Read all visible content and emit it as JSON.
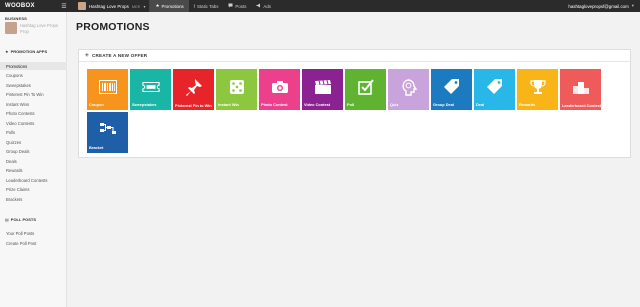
{
  "topbar": {
    "logo": "WOOBOX",
    "page_name": "Hashtag Love Props",
    "page_tag": "MEE",
    "nav": [
      {
        "label": "Promotions",
        "icon": "star-icon",
        "glyph": "★",
        "active": true
      },
      {
        "label": "Static Tabs",
        "icon": "facebook-icon",
        "glyph": "f",
        "active": false
      },
      {
        "label": "Posts",
        "icon": "speech-bubble-icon",
        "glyph": "💬",
        "active": false
      },
      {
        "label": "Ads",
        "icon": "megaphone-icon",
        "glyph": "📣",
        "active": false
      }
    ],
    "user_email": "hashtaglovepropsf@gmail.com"
  },
  "sidebar": {
    "business_label": "BUSINESS",
    "business_name": "Hashtag Love Props Prop",
    "promotion_apps_label": "PROMOTION APPS",
    "items": [
      {
        "label": "Promotions",
        "active": true
      },
      {
        "label": "Coupons",
        "active": false
      },
      {
        "label": "Sweepstakes",
        "active": false
      },
      {
        "label": "Pinterest Pin To Win",
        "active": false
      },
      {
        "label": "Instant Wins",
        "active": false
      },
      {
        "label": "Photo Contests",
        "active": false
      },
      {
        "label": "Video Contests",
        "active": false
      },
      {
        "label": "Polls",
        "active": false
      },
      {
        "label": "Quizzes",
        "active": false
      },
      {
        "label": "Group Deals",
        "active": false
      },
      {
        "label": "Deals",
        "active": false
      },
      {
        "label": "Rewards",
        "active": false
      },
      {
        "label": "Leaderboard Contests",
        "active": false
      },
      {
        "label": "Prize Claims",
        "active": false
      },
      {
        "label": "Brackets",
        "active": false
      }
    ],
    "poll_posts_label": "POLL POSTS",
    "poll_items": [
      {
        "label": "Your Poll Posts"
      },
      {
        "label": "Create Poll Post"
      }
    ]
  },
  "main": {
    "title": "PROMOTIONS",
    "panel_title": "CREATE A NEW OFFER",
    "tiles": [
      {
        "label": "Coupon",
        "color": "#f7941d",
        "icon": "barcode-icon"
      },
      {
        "label": "Sweepstakes",
        "color": "#19b5a5",
        "icon": "ticket-icon"
      },
      {
        "label": "Pinterest Pin to Win",
        "color": "#e8242b",
        "icon": "pushpin-icon"
      },
      {
        "label": "Instant Win",
        "color": "#8dc63f",
        "icon": "dice-icon"
      },
      {
        "label": "Photo Contest",
        "color": "#ec3f8c",
        "icon": "camera-icon"
      },
      {
        "label": "Video Contest",
        "color": "#8b2291",
        "icon": "clapperboard-icon"
      },
      {
        "label": "Poll",
        "color": "#5fb330",
        "icon": "checkbox-icon"
      },
      {
        "label": "Quiz",
        "color": "#c9a3dc",
        "icon": "brain-head-icon"
      },
      {
        "label": "Group Deal",
        "color": "#1c7ac0",
        "icon": "price-tag-icon"
      },
      {
        "label": "Deal",
        "color": "#29b6e8",
        "icon": "price-tag-icon"
      },
      {
        "label": "Rewards",
        "color": "#f9b418",
        "icon": "trophy-icon"
      },
      {
        "label": "Leaderboard Contest",
        "color": "#ef5a5b",
        "icon": "podium-icon"
      },
      {
        "label": "Bracket",
        "color": "#1f5fa8",
        "icon": "bracket-icon"
      }
    ]
  }
}
